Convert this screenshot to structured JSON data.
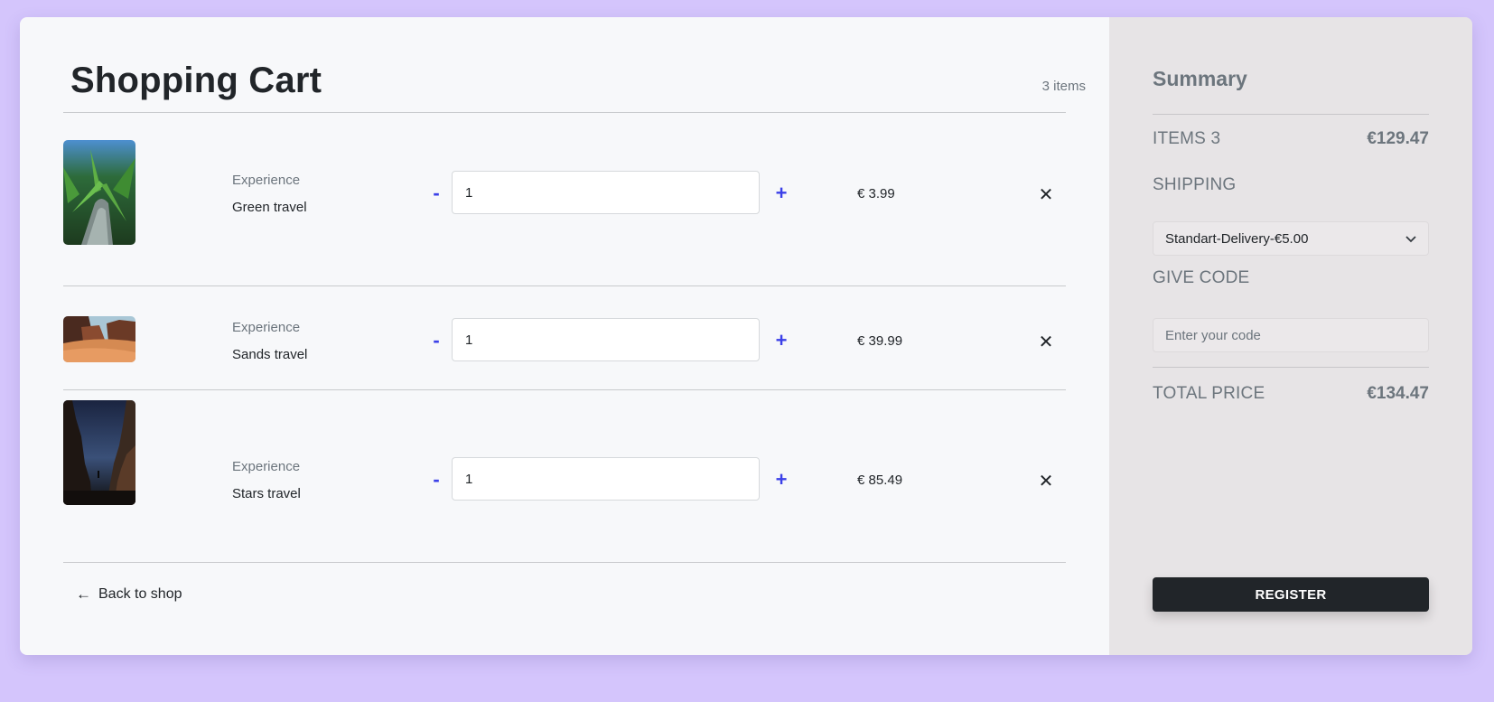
{
  "cart": {
    "title": "Shopping Cart",
    "count_text": "3 items",
    "items": [
      {
        "category": "Experience",
        "name": "Green travel",
        "quantity": "1",
        "price": "€ 3.99",
        "minus": "-",
        "plus": "+",
        "remove": "✕",
        "image": "jungle-photo"
      },
      {
        "category": "Experience",
        "name": "Sands travel",
        "quantity": "1",
        "price": "€ 39.99",
        "minus": "-",
        "plus": "+",
        "remove": "✕",
        "image": "desert-photo"
      },
      {
        "category": "Experience",
        "name": "Stars travel",
        "quantity": "1",
        "price": "€ 85.49",
        "minus": "-",
        "plus": "+",
        "remove": "✕",
        "image": "canyon-night-photo"
      }
    ],
    "back_label": "Back to shop",
    "back_icon": "arrow-left-icon"
  },
  "summary": {
    "title": "Summary",
    "items_label": "ITEMS 3",
    "items_total": "€129.47",
    "shipping_label": "SHIPPING",
    "shipping_selected": "Standart-Delivery-€5.00",
    "code_label": "GIVE CODE",
    "code_placeholder": "Enter your code",
    "total_label": "TOTAL PRICE",
    "total_value": "€134.47",
    "register_label": "REGISTER"
  },
  "colors": {
    "page_background": "#d4c5fc",
    "cart_background": "#f7f8fa",
    "summary_background": "#e7e4e6",
    "accent": "#3b40e8",
    "dark_button": "#212529"
  }
}
